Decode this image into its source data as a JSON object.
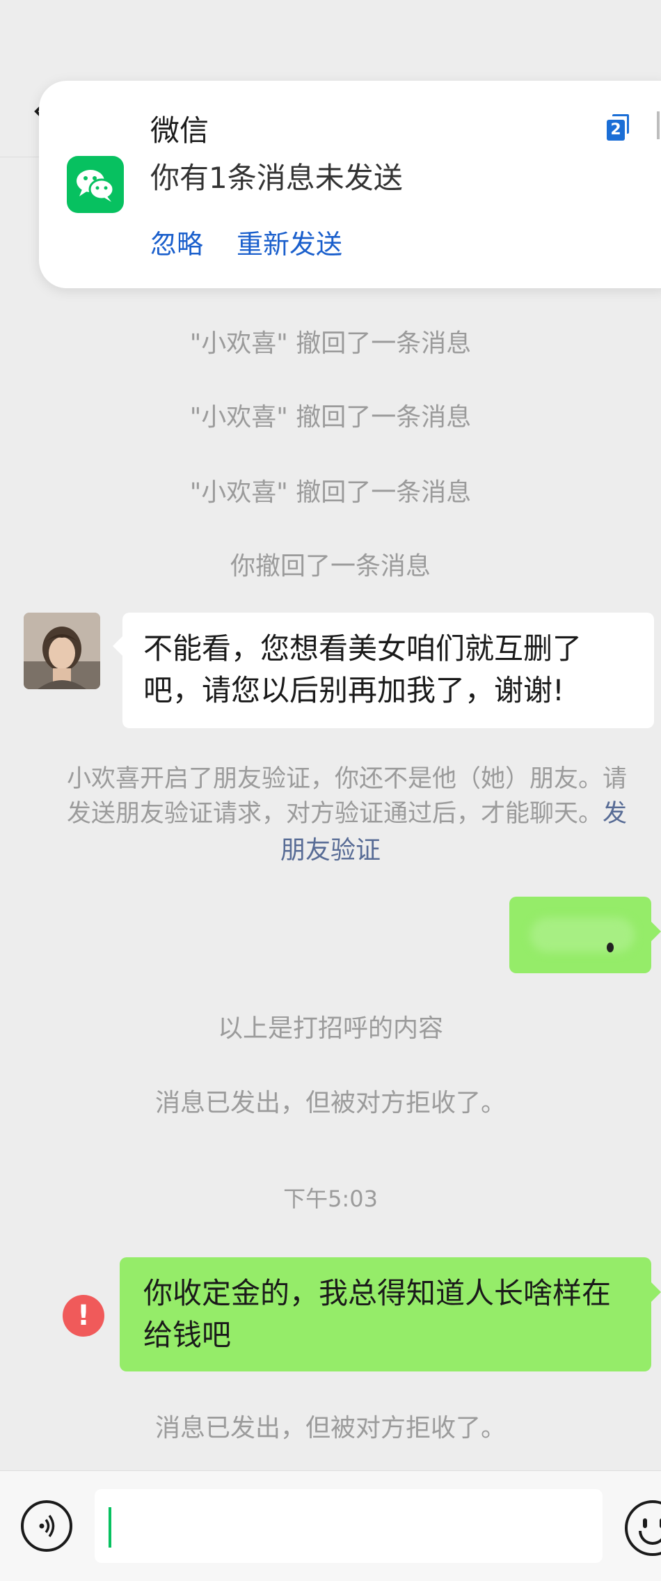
{
  "notification": {
    "app_name": "微信",
    "message": "你有1条消息未发送",
    "actions": [
      "忽略",
      "重新发送"
    ],
    "badge": "2",
    "icon": "wechat-logo-icon"
  },
  "system_messages": {
    "recall_1": "\"小欢喜\" 撤回了一条消息",
    "recall_2": "\"小欢喜\" 撤回了一条消息",
    "recall_3": "\"小欢喜\" 撤回了一条消息",
    "recall_self": "你撤回了一条消息",
    "verify_line1": "小欢喜开启了朋友验证，你还不是他（她）朋友。请",
    "verify_line2_text": "发送朋友验证请求，对方验证通过后，才能聊天。",
    "verify_line2_link": "发",
    "verify_link": "朋友验证",
    "greeting_note": "以上是打招呼的内容",
    "rejected_1": "消息已发出，但被对方拒收了。",
    "timestamp": "下午5:03",
    "rejected_2": "消息已发出，但被对方拒收了。"
  },
  "messages": {
    "incoming_text": "不能看，您想看美女咱们就互删了吧，请您以后别再加我了，谢谢!",
    "outgoing_text": "你收定金的，我总得知道人长啥样在给钱吧",
    "error_mark": "!"
  },
  "input_bar": {
    "voice_icon": "voice-icon",
    "emoji_icon": "emoji-icon",
    "value": ""
  },
  "colors": {
    "background": "#ededed",
    "outgoing_bubble": "#95ec69",
    "incoming_bubble": "#ffffff",
    "link": "#576b95",
    "notification_action": "#1a5fcc",
    "error": "#f05a5a",
    "wechat_green": "#07c160"
  }
}
